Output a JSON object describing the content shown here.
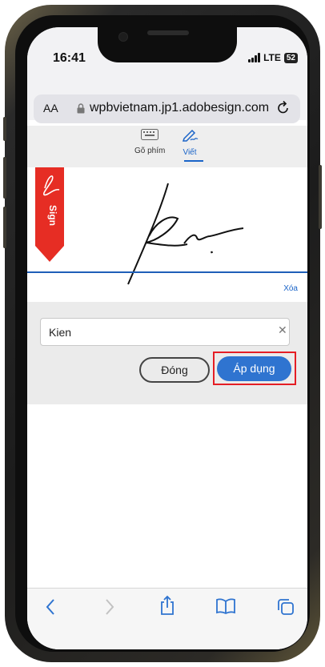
{
  "status": {
    "time": "16:41",
    "network": "LTE",
    "battery": "52"
  },
  "browser": {
    "text_size": "AA",
    "url": "wpbvietnam.jp1.adobesign.com"
  },
  "modes": [
    {
      "label": "Gõ phím",
      "icon": "keyboard-icon",
      "selected": false
    },
    {
      "label": "Viết",
      "icon": "pen-draw-icon",
      "selected": true
    }
  ],
  "signature": {
    "ribbon_text": "Sign",
    "clear_label": "Xóa"
  },
  "name_field": {
    "value": "Kien"
  },
  "actions": {
    "close_label": "Đóng",
    "apply_label": "Áp dụng"
  },
  "colors": {
    "accent": "#2f74d0",
    "ribbon": "#e62d24",
    "highlight": "#e51e25"
  },
  "toolbar_icons": [
    "back-icon",
    "forward-icon",
    "share-icon",
    "bookmarks-icon",
    "tabs-icon"
  ]
}
